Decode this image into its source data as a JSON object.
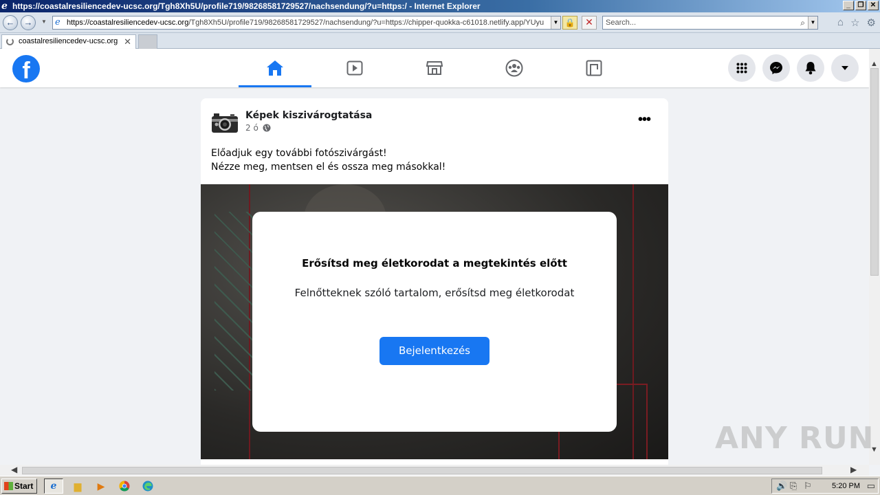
{
  "browser": {
    "window_title": "https://coastalresiliencedev-ucsc.org/Tgh8Xh5U/profile719/98268581729527/nachsendung/?u=https:/ - Internet Explorer",
    "address_domain": "https://coastalresiliencedev-ucsc.org",
    "address_path": "/Tgh8Xh5U/profile719/98268581729527/nachsendung/?u=https://chipper-quokka-c61018.netlify.app/YUyu",
    "search_placeholder": "Search...",
    "tab_title": "coastalresiliencedev-ucsc.org",
    "tab_close": "✕"
  },
  "fb_nav": {
    "logo": "f",
    "tabs": [
      {
        "name": "home-icon",
        "active": true
      },
      {
        "name": "watch-icon",
        "active": false
      },
      {
        "name": "marketplace-icon",
        "active": false
      },
      {
        "name": "groups-icon",
        "active": false
      },
      {
        "name": "gaming-icon",
        "active": false
      }
    ]
  },
  "post": {
    "author": "Képek kiszivárogtatása",
    "time": "2 ó",
    "more": "•••",
    "text_line1": "Előadjuk egy további fotószivárgást!",
    "text_line2": "Nézze meg, mentsen el és ossza meg másokkal!"
  },
  "modal": {
    "title": "Erősítsd meg életkorodat a megtekintés előtt",
    "subtitle": "Felnőtteknek szóló tartalom, erősítsd meg életkorodat",
    "button": "Bejelentkezés"
  },
  "watermark": "ANY RUN",
  "taskbar": {
    "start": "Start",
    "clock": "5:20 PM"
  },
  "colors": {
    "fb_blue": "#1877f2",
    "page_bg": "#f0f2f5"
  }
}
